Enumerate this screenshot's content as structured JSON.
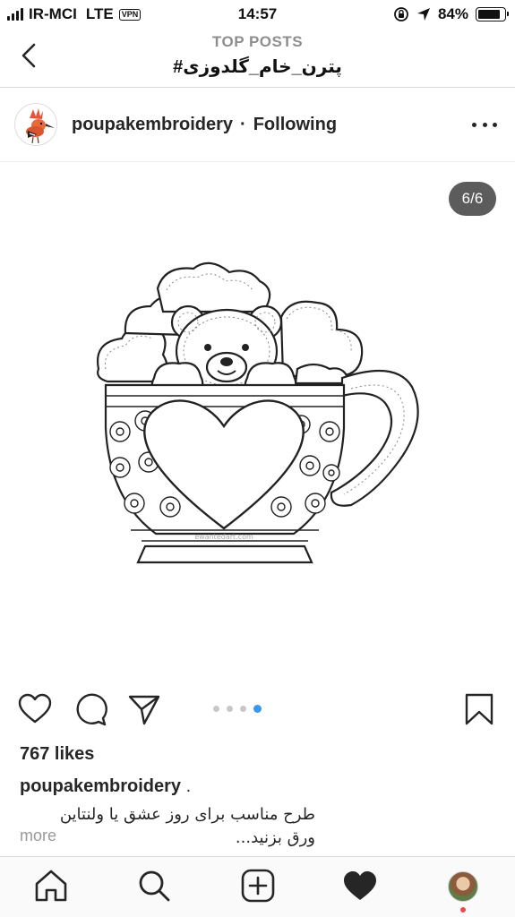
{
  "status_bar": {
    "carrier": "IR-MCI",
    "network": "LTE",
    "vpn": "VPN",
    "time": "14:57",
    "battery": "84%"
  },
  "header": {
    "subtitle": "TOP POSTS",
    "title": "#پترن_خام_گلدوزی"
  },
  "post": {
    "username": "poupakembroidery",
    "separator": "·",
    "follow_status": "Following",
    "media_counter": "6/6",
    "carousel": {
      "total": 4,
      "active_index": 3
    },
    "likes": "767 likes",
    "caption_user": "poupakembroidery",
    "caption_dot": ".",
    "caption_line1": "طرح مناسب برای روز عشق یا ولنتاین",
    "caption_line2": "ورق بزنید...",
    "more_label": "more",
    "watermark": "ewantedart.com"
  },
  "icons": {
    "back": "chevron-left-icon",
    "more": "more-horizontal-icon",
    "like": "heart-outline-icon",
    "comment": "comment-icon",
    "share": "send-icon",
    "save": "bookmark-icon",
    "nav": [
      "home-icon",
      "search-icon",
      "add-post-icon",
      "activity-heart-icon",
      "profile-avatar"
    ]
  },
  "colors": {
    "accent": "#3897f0",
    "text": "#262626",
    "muted": "#8e8e8e",
    "notification": "#ed4956"
  }
}
